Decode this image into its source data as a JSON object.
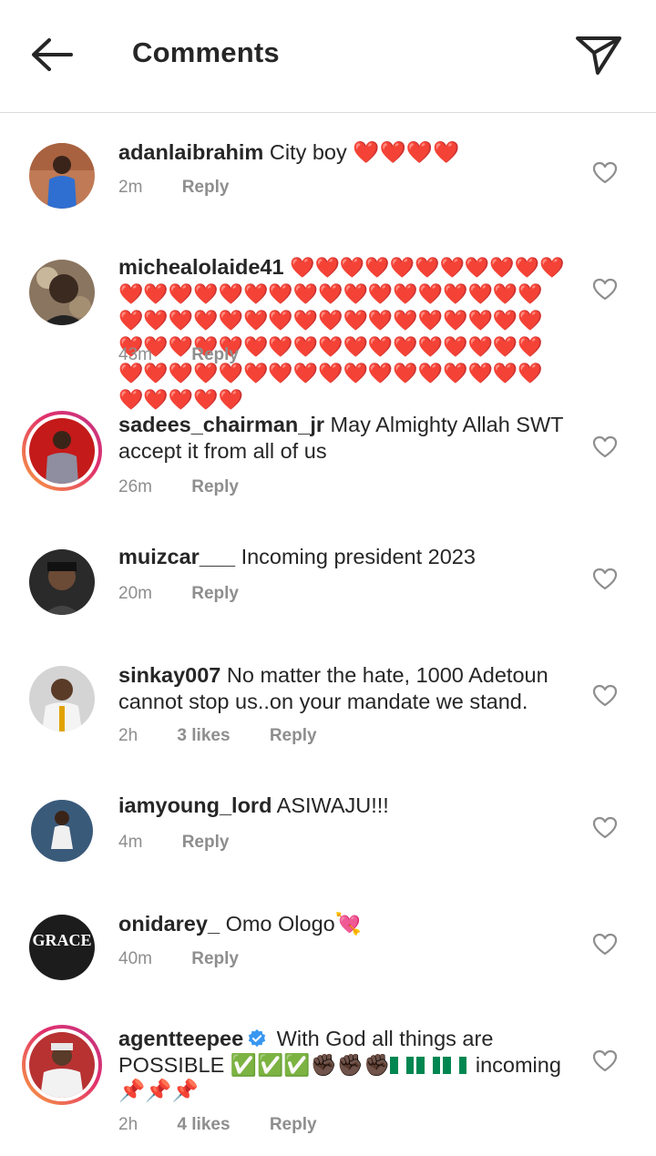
{
  "header": {
    "title": "Comments",
    "back_icon": "arrow-left-icon",
    "send_icon": "paper-plane-icon"
  },
  "comments": [
    {
      "username": "adanlaibrahim",
      "text": "City boy",
      "emoji": "❤️❤️❤️❤️",
      "time": "2m",
      "likes": "",
      "reply": "Reply"
    },
    {
      "username": "michealolaide41",
      "text": "",
      "emoji": "❤️❤️❤️❤️❤️❤️❤️❤️❤️❤️❤️❤️❤️❤️❤️❤️❤️❤️❤️❤️❤️❤️❤️❤️❤️❤️❤️❤️❤️❤️❤️❤️❤️❤️❤️❤️❤️❤️❤️❤️❤️❤️❤️❤️❤️❤️❤️❤️❤️❤️❤️❤️❤️❤️❤️❤️❤️❤️❤️❤️❤️❤️❤️❤️❤️❤️❤️❤️❤️❤️❤️❤️❤️❤️❤️❤️❤️❤️❤️❤️❤️❤️❤️❤️",
      "time": "43m",
      "likes": "",
      "reply": "Reply"
    },
    {
      "username": "sadees_chairman_jr",
      "text": "May Almighty Allah SWT accept it from all of us",
      "emoji": "",
      "time": "26m",
      "likes": "",
      "reply": "Reply"
    },
    {
      "username": "muizcar___",
      "text": "Incoming president 2023",
      "emoji": "",
      "time": "20m",
      "likes": "",
      "reply": "Reply"
    },
    {
      "username": "sinkay007",
      "text": "No matter the hate, 1000 Adetoun cannot stop us..on your mandate we stand.",
      "emoji": "",
      "time": "2h",
      "likes": "3 likes",
      "reply": "Reply"
    },
    {
      "username": "iamyoung_lord",
      "text": "ASIWAJU!!!",
      "emoji": "",
      "time": "4m",
      "likes": "",
      "reply": "Reply"
    },
    {
      "username": "onidarey_",
      "text": "Omo Ologo",
      "emoji": "💘",
      "time": "40m",
      "likes": "",
      "reply": "Reply",
      "avatar_text": "GRACE"
    },
    {
      "username": "agentteepee",
      "text": "With God all things are POSSIBLE",
      "emoji_checks": "✅✅✅",
      "emoji_fists": "✊🏿✊🏿✊🏿",
      "text2": "incoming",
      "emoji_pins": "📌📌📌",
      "time": "2h",
      "likes": "4 likes",
      "reply": "Reply",
      "verified_icon": "verified-badge-icon"
    }
  ],
  "colors": {
    "text": "#262626",
    "secondary": "#8e8e8e",
    "divider": "#dbdbdb",
    "heart": "#e0152b",
    "verified": "#3897f0"
  }
}
